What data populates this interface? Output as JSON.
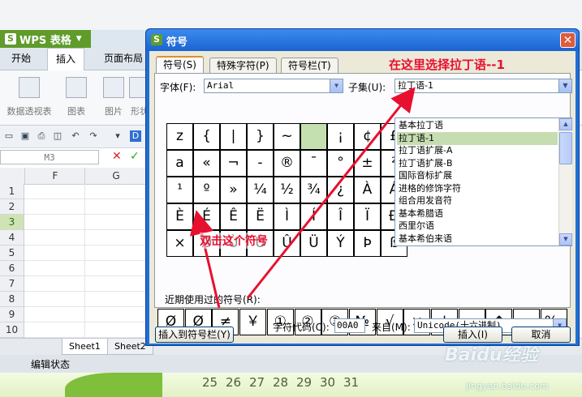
{
  "wps": {
    "app_title": "WPS 表格",
    "ribbon_tabs": [
      "开始",
      "插入",
      "页面布局"
    ],
    "ribbon_buttons": [
      "数据透视表",
      "图表",
      "图片",
      "形状"
    ],
    "name_box": "M3",
    "columns": [
      "F",
      "G"
    ],
    "rows": [
      "1",
      "2",
      "3",
      "4",
      "5",
      "6",
      "7",
      "8",
      "9",
      "10"
    ],
    "selected_row": "3",
    "sheet_tabs": [
      "Sheet1",
      "Sheet2"
    ],
    "status": "编辑状态"
  },
  "desktop": {
    "calendar_days": [
      "25",
      "26",
      "27",
      "28",
      "29",
      "30",
      "31"
    ],
    "watermark": "Baidu经验",
    "watermark_sub": "jingyan.baidu.com"
  },
  "dialog": {
    "title": "符号",
    "close": "✕",
    "tabs": [
      "符号(S)",
      "特殊字符(P)",
      "符号栏(T)"
    ],
    "font_label": "字体(F):",
    "font_value": "Arial",
    "subset_label": "子集(U):",
    "subset_value": "拉丁语-1",
    "subset_options": [
      "基本拉丁语",
      "拉丁语-1",
      "拉丁语扩展-A",
      "拉丁语扩展-B",
      "国际音标扩展",
      "进格的修饰字符",
      "组合用发音符",
      "基本希腊语",
      "西里尔语",
      "基本希伯来语"
    ],
    "subset_selected_index": 1,
    "symbol_rows": [
      [
        "z",
        "{",
        "|",
        "}",
        "~",
        "",
        "¡",
        "¢",
        "£"
      ],
      [
        "a",
        "«",
        "¬",
        "-",
        "®",
        "¯",
        "°",
        "±",
        "²"
      ],
      [
        "¹",
        "º",
        "»",
        "¼",
        "½",
        "¾",
        "¿",
        "À",
        "Á"
      ],
      [
        "È",
        "É",
        "Ê",
        "Ë",
        "Ì",
        "Í",
        "Î",
        "Ï",
        "Ð"
      ],
      [
        "×",
        "Ø",
        "Ù",
        "Ú",
        "Û",
        "Ü",
        "Ý",
        "Þ",
        "ß"
      ]
    ],
    "recent_label": "近期使用过的符号(R):",
    "recent_symbols": [
      "Ø",
      "Ø",
      "≠",
      "￥",
      "①",
      "②",
      "③",
      "№",
      "√",
      "×",
      "↓",
      "→",
      "↑",
      "←",
      "‰"
    ],
    "char_code_label": "字符代码(C):",
    "char_code_value": "00A0",
    "from_label": "来自(M):",
    "from_value": "Unicode(十六进制)",
    "insert_to_bar": "插入到符号栏(Y)",
    "insert": "插入(I)",
    "cancel": "取消"
  },
  "annotations": {
    "top": "在这里选择拉丁语--1",
    "left": "双击这个符号"
  },
  "colors": {
    "dialog_title": "#1c63d0",
    "wps_green": "#5f9c2b",
    "annotation_red": "#e8102f",
    "highlight": "#c5e0b0"
  }
}
